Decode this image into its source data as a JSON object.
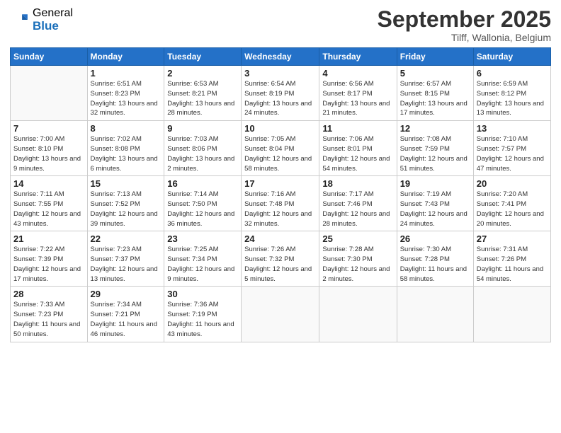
{
  "logo": {
    "general": "General",
    "blue": "Blue"
  },
  "title": {
    "month": "September 2025",
    "location": "Tilff, Wallonia, Belgium"
  },
  "weekdays": [
    "Sunday",
    "Monday",
    "Tuesday",
    "Wednesday",
    "Thursday",
    "Friday",
    "Saturday"
  ],
  "weeks": [
    [
      {
        "day": "",
        "info": ""
      },
      {
        "day": "1",
        "info": "Sunrise: 6:51 AM\nSunset: 8:23 PM\nDaylight: 13 hours\nand 32 minutes."
      },
      {
        "day": "2",
        "info": "Sunrise: 6:53 AM\nSunset: 8:21 PM\nDaylight: 13 hours\nand 28 minutes."
      },
      {
        "day": "3",
        "info": "Sunrise: 6:54 AM\nSunset: 8:19 PM\nDaylight: 13 hours\nand 24 minutes."
      },
      {
        "day": "4",
        "info": "Sunrise: 6:56 AM\nSunset: 8:17 PM\nDaylight: 13 hours\nand 21 minutes."
      },
      {
        "day": "5",
        "info": "Sunrise: 6:57 AM\nSunset: 8:15 PM\nDaylight: 13 hours\nand 17 minutes."
      },
      {
        "day": "6",
        "info": "Sunrise: 6:59 AM\nSunset: 8:12 PM\nDaylight: 13 hours\nand 13 minutes."
      }
    ],
    [
      {
        "day": "7",
        "info": "Sunrise: 7:00 AM\nSunset: 8:10 PM\nDaylight: 13 hours\nand 9 minutes."
      },
      {
        "day": "8",
        "info": "Sunrise: 7:02 AM\nSunset: 8:08 PM\nDaylight: 13 hours\nand 6 minutes."
      },
      {
        "day": "9",
        "info": "Sunrise: 7:03 AM\nSunset: 8:06 PM\nDaylight: 13 hours\nand 2 minutes."
      },
      {
        "day": "10",
        "info": "Sunrise: 7:05 AM\nSunset: 8:04 PM\nDaylight: 12 hours\nand 58 minutes."
      },
      {
        "day": "11",
        "info": "Sunrise: 7:06 AM\nSunset: 8:01 PM\nDaylight: 12 hours\nand 54 minutes."
      },
      {
        "day": "12",
        "info": "Sunrise: 7:08 AM\nSunset: 7:59 PM\nDaylight: 12 hours\nand 51 minutes."
      },
      {
        "day": "13",
        "info": "Sunrise: 7:10 AM\nSunset: 7:57 PM\nDaylight: 12 hours\nand 47 minutes."
      }
    ],
    [
      {
        "day": "14",
        "info": "Sunrise: 7:11 AM\nSunset: 7:55 PM\nDaylight: 12 hours\nand 43 minutes."
      },
      {
        "day": "15",
        "info": "Sunrise: 7:13 AM\nSunset: 7:52 PM\nDaylight: 12 hours\nand 39 minutes."
      },
      {
        "day": "16",
        "info": "Sunrise: 7:14 AM\nSunset: 7:50 PM\nDaylight: 12 hours\nand 36 minutes."
      },
      {
        "day": "17",
        "info": "Sunrise: 7:16 AM\nSunset: 7:48 PM\nDaylight: 12 hours\nand 32 minutes."
      },
      {
        "day": "18",
        "info": "Sunrise: 7:17 AM\nSunset: 7:46 PM\nDaylight: 12 hours\nand 28 minutes."
      },
      {
        "day": "19",
        "info": "Sunrise: 7:19 AM\nSunset: 7:43 PM\nDaylight: 12 hours\nand 24 minutes."
      },
      {
        "day": "20",
        "info": "Sunrise: 7:20 AM\nSunset: 7:41 PM\nDaylight: 12 hours\nand 20 minutes."
      }
    ],
    [
      {
        "day": "21",
        "info": "Sunrise: 7:22 AM\nSunset: 7:39 PM\nDaylight: 12 hours\nand 17 minutes."
      },
      {
        "day": "22",
        "info": "Sunrise: 7:23 AM\nSunset: 7:37 PM\nDaylight: 12 hours\nand 13 minutes."
      },
      {
        "day": "23",
        "info": "Sunrise: 7:25 AM\nSunset: 7:34 PM\nDaylight: 12 hours\nand 9 minutes."
      },
      {
        "day": "24",
        "info": "Sunrise: 7:26 AM\nSunset: 7:32 PM\nDaylight: 12 hours\nand 5 minutes."
      },
      {
        "day": "25",
        "info": "Sunrise: 7:28 AM\nSunset: 7:30 PM\nDaylight: 12 hours\nand 2 minutes."
      },
      {
        "day": "26",
        "info": "Sunrise: 7:30 AM\nSunset: 7:28 PM\nDaylight: 11 hours\nand 58 minutes."
      },
      {
        "day": "27",
        "info": "Sunrise: 7:31 AM\nSunset: 7:26 PM\nDaylight: 11 hours\nand 54 minutes."
      }
    ],
    [
      {
        "day": "28",
        "info": "Sunrise: 7:33 AM\nSunset: 7:23 PM\nDaylight: 11 hours\nand 50 minutes."
      },
      {
        "day": "29",
        "info": "Sunrise: 7:34 AM\nSunset: 7:21 PM\nDaylight: 11 hours\nand 46 minutes."
      },
      {
        "day": "30",
        "info": "Sunrise: 7:36 AM\nSunset: 7:19 PM\nDaylight: 11 hours\nand 43 minutes."
      },
      {
        "day": "",
        "info": ""
      },
      {
        "day": "",
        "info": ""
      },
      {
        "day": "",
        "info": ""
      },
      {
        "day": "",
        "info": ""
      }
    ]
  ]
}
